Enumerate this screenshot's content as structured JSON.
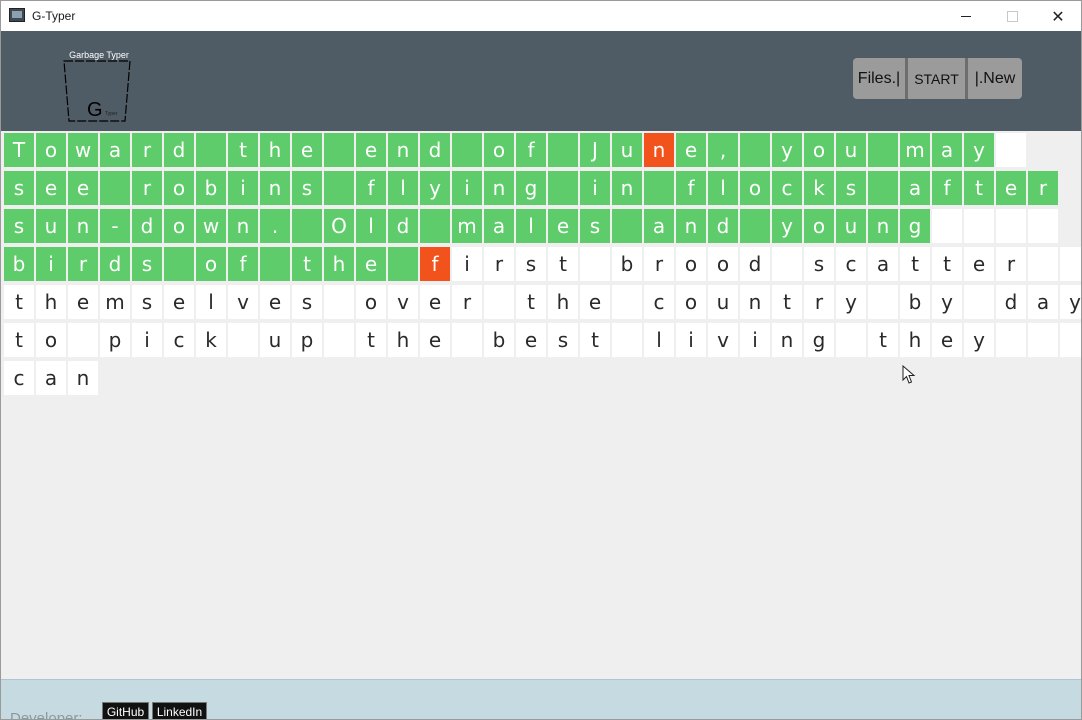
{
  "window": {
    "title": "G-Typer",
    "minimize": "minimize",
    "maximize": "maximize",
    "close": "✕"
  },
  "header": {
    "logo_caption": "Garbage Typer",
    "logo_letter": "G",
    "logo_small": "Typer",
    "buttons": {
      "files": "Files.|",
      "start": "START",
      "new": "|.New"
    }
  },
  "typing": {
    "colors": {
      "correct": "#5fcc6c",
      "error": "#f2521b",
      "pending": "#ffffff"
    },
    "lines": [
      {
        "text": "Toward the end of June, you may ",
        "state": "cccccccccccccccccccceccccccccccpp"
      },
      {
        "text": "see robins flying in flocks after",
        "state": "ccccccccccccccccccccccccccccccccc"
      },
      {
        "text": "sun-down. Old males and young    ",
        "state": "cccccccccccccccccccccccccccccpppp"
      },
      {
        "text": "birds of the first brood scatter  ",
        "state": "ccccccccccccceppppppppppppppppppppp"
      },
      {
        "text": "themselves over the country by day",
        "state": "pppppppppppppppppppppppppppppppppp"
      },
      {
        "text": "to pick up the best living they   ",
        "state": "pppppppppppppppppppppppppppppppppp"
      },
      {
        "text": "can",
        "state": "ppp"
      }
    ]
  },
  "footer": {
    "developer_label": "Developer:",
    "github": "GitHub",
    "linkedin": "LinkedIn"
  }
}
